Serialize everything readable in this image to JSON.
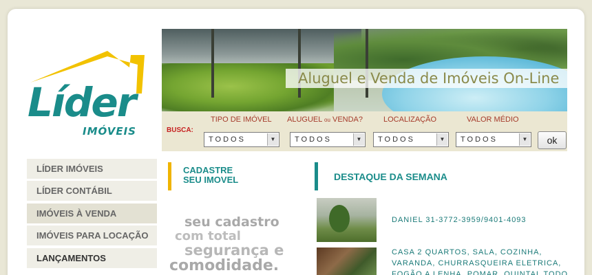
{
  "brand": {
    "name": "Líder",
    "sub": "IMÓVEIS",
    "colors": {
      "teal": "#1a8c8a",
      "yellow": "#f0b400"
    }
  },
  "banner": {
    "title": "Aluguel e Venda de Imóveis On-Line"
  },
  "search": {
    "label": "BUSCA:",
    "fields": [
      {
        "label": "TIPO DE IMÓVEL",
        "value": "TODOS"
      },
      {
        "label": "ALUGUEL",
        "label_small": "ou",
        "label_end": "VENDA?",
        "value": "TODOS"
      },
      {
        "label": "LOCALIZAÇÃO",
        "value": "TODOS"
      },
      {
        "label": "VALOR MÉDIO",
        "value": "TODOS"
      }
    ],
    "submit": "ok"
  },
  "sidebar": {
    "items": [
      {
        "label": "LÍDER IMÓVEIS"
      },
      {
        "label": "LÍDER CONTÁBIL"
      },
      {
        "label": "IMÓVEIS À VENDA"
      },
      {
        "label": "IMÓVEIS PARA LOCAÇÃO"
      },
      {
        "label": "LANÇAMENTOS"
      }
    ]
  },
  "cadastre": {
    "heading_line1": "CADASTRE",
    "heading_line2": "SEU IMOVEL",
    "promo": [
      "seu cadastro",
      "com total",
      "segurança e",
      "comodidade."
    ]
  },
  "destaque": {
    "heading": "DESTAQUE DA SEMANA",
    "items": [
      {
        "lines": [
          "DANIEL 31-3772-3959/9401-4093"
        ]
      },
      {
        "lines": [
          "CASA 2 QUARTOS, SALA, COZINHA,",
          "VARANDA, CHURRASQUEIRA ELETRICA,",
          "FOGÃO A LENHA, POMAR, QUINTAL TODO"
        ]
      }
    ]
  }
}
